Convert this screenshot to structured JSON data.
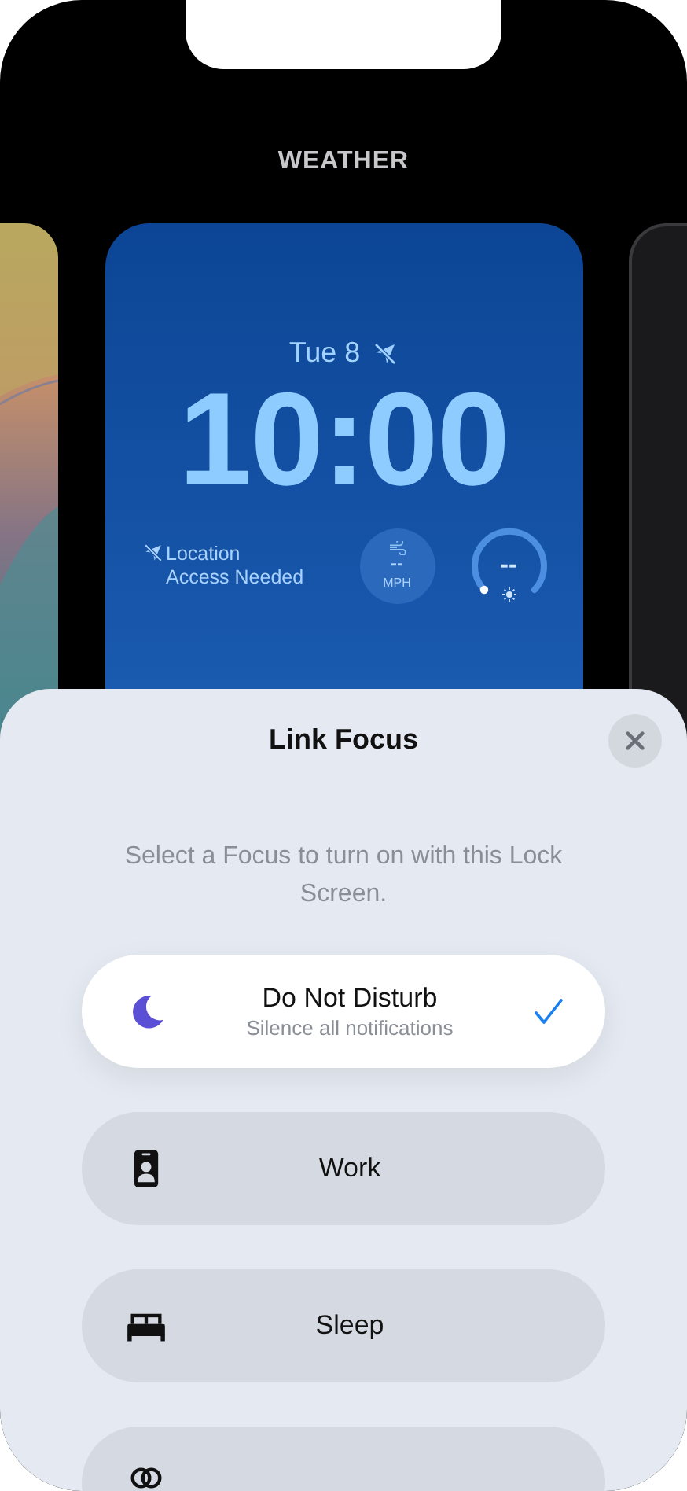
{
  "header": {
    "title": "WEATHER"
  },
  "lock_screen": {
    "date": "Tue 8",
    "time": "10:00",
    "location_notice": "Location Access Needed",
    "wind_widget": {
      "value": "--",
      "unit": "MPH"
    },
    "gauge_widget": {
      "value": "--"
    }
  },
  "sheet": {
    "title": "Link Focus",
    "description": "Select a Focus to turn on with this Lock Screen.",
    "focus_options": [
      {
        "kind": "moon",
        "label": "Do Not Disturb",
        "subtitle": "Silence all notifications",
        "selected": true
      },
      {
        "kind": "badge",
        "label": "Work",
        "selected": false
      },
      {
        "kind": "bed",
        "label": "Sleep",
        "selected": false
      },
      {
        "kind": "mindful",
        "selected": false
      }
    ]
  }
}
